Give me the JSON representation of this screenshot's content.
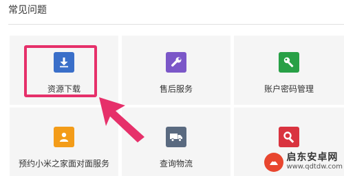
{
  "section": {
    "title": "常见问题"
  },
  "items": [
    {
      "label": "资源下载",
      "icon": "download-icon",
      "color": "#3a6fc9"
    },
    {
      "label": "售后服务",
      "icon": "wrench-icon",
      "color": "#7b57c8"
    },
    {
      "label": "账户密码管理",
      "icon": "key-icon",
      "color": "#28a046"
    },
    {
      "label": "预约小米之家面对面服务",
      "icon": "person-icon",
      "color": "#f39c19"
    },
    {
      "label": "查询物流",
      "icon": "truck-icon",
      "color": "#5a6a80"
    },
    {
      "label": "",
      "icon": "search-icon",
      "color": "#d9333f"
    }
  ],
  "annotation": {
    "highlight_color": "#e6306a"
  },
  "watermark": {
    "name": "启东安卓网",
    "url": "www.qdtdw.com"
  }
}
